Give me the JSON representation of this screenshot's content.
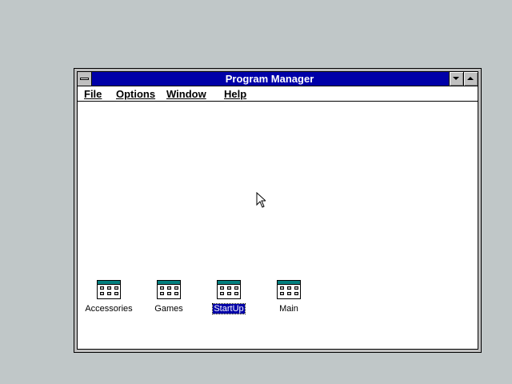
{
  "window": {
    "title": "Program Manager"
  },
  "menu": {
    "items": [
      {
        "label": "File",
        "mnemonic": "F"
      },
      {
        "label": "Options",
        "mnemonic": "O"
      },
      {
        "label": "Window",
        "mnemonic": "W"
      },
      {
        "label": "Help",
        "mnemonic": "H"
      }
    ]
  },
  "groups": [
    {
      "label": "Accessories",
      "selected": false
    },
    {
      "label": "Games",
      "selected": false
    },
    {
      "label": "StartUp",
      "selected": true
    },
    {
      "label": "Main",
      "selected": false
    }
  ],
  "colors": {
    "desktop": "#c0c7c8",
    "titlebar": "#0000a8",
    "selection": "#0000a8"
  }
}
